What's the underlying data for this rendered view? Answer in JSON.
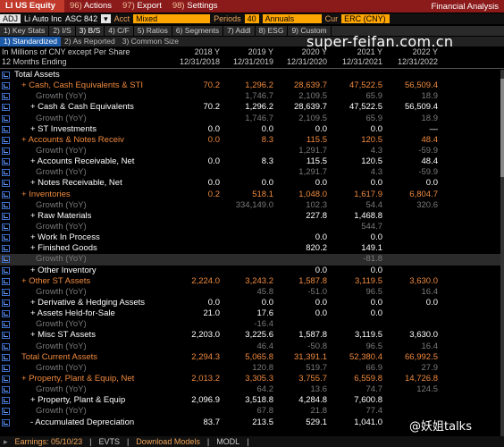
{
  "top": {
    "ticker": "LI US Equity",
    "menus": [
      {
        "num": "96)",
        "label": "Actions"
      },
      {
        "num": "97)",
        "label": "Export"
      },
      {
        "num": "98)",
        "label": "Settings"
      }
    ],
    "title": "Financial Analysis"
  },
  "params": {
    "adj": "ADJ",
    "company": "Li Auto Inc",
    "asc": "ASC 842",
    "acct_label": "Acct",
    "acct_value": "Mixed",
    "periods_label": "Periods",
    "periods_value": "40",
    "freq": "Annuals",
    "cur_label": "Cur",
    "cur_value": "ERC (CNY)"
  },
  "tabs": [
    "1) Key Stats",
    "2) I/S",
    "3) B/S",
    "4) C/F",
    "5) Ratios",
    "6) Segments",
    "7) Addl",
    "8) ESG",
    "9) Custom"
  ],
  "subtabs": [
    "1) Standardized",
    "2) As Reported",
    "3) Common Size"
  ],
  "subtab_active": 0,
  "watermark": "super-feifan.com.cn",
  "header": {
    "units": "In Millions of CNY except Per Share",
    "period_label": "12 Months Ending",
    "years": [
      "2018 Y",
      "2019 Y",
      "2020 Y",
      "2021 Y",
      "2022 Y"
    ],
    "dates": [
      "12/31/2018",
      "12/31/2019",
      "12/31/2020",
      "12/31/2021",
      "12/31/2022"
    ]
  },
  "rows": [
    {
      "kind": "sec",
      "label": "Total Assets",
      "values": [
        "",
        "",
        "",
        "",
        ""
      ]
    },
    {
      "kind": "main",
      "label": "+ Cash, Cash Equivalents & STI",
      "values": [
        "70.2",
        "1,296.2",
        "28,639.7",
        "47,522.5",
        "56,509.4"
      ]
    },
    {
      "kind": "g",
      "label": "Growth (YoY)",
      "values": [
        "",
        "1,746.7",
        "2,109.5",
        "65.9",
        "18.9"
      ]
    },
    {
      "kind": "sub",
      "label": "+ Cash & Cash Equivalents",
      "values": [
        "70.2",
        "1,296.2",
        "28,639.7",
        "47,522.5",
        "56,509.4"
      ]
    },
    {
      "kind": "g",
      "label": "Growth (YoY)",
      "values": [
        "",
        "1,746.7",
        "2,109.5",
        "65.9",
        "18.9"
      ]
    },
    {
      "kind": "sub",
      "label": "+ ST Investments",
      "values": [
        "0.0",
        "0.0",
        "0.0",
        "0.0",
        "—"
      ]
    },
    {
      "kind": "main",
      "label": "+ Accounts & Notes Receiv",
      "values": [
        "0.0",
        "8.3",
        "115.5",
        "120.5",
        "48.4"
      ]
    },
    {
      "kind": "g",
      "label": "Growth (YoY)",
      "values": [
        "",
        "",
        "1,291.7",
        "4.3",
        "-59.9"
      ]
    },
    {
      "kind": "sub",
      "label": "+ Accounts Receivable, Net",
      "values": [
        "0.0",
        "8.3",
        "115.5",
        "120.5",
        "48.4"
      ]
    },
    {
      "kind": "g",
      "label": "Growth (YoY)",
      "values": [
        "",
        "",
        "1,291.7",
        "4.3",
        "-59.9"
      ]
    },
    {
      "kind": "sub",
      "label": "+ Notes Receivable, Net",
      "values": [
        "0.0",
        "0.0",
        "0.0",
        "0.0",
        "0.0"
      ]
    },
    {
      "kind": "main",
      "label": "+ Inventories",
      "values": [
        "0.2",
        "518.1",
        "1,048.0",
        "1,617.9",
        "6,804.7"
      ]
    },
    {
      "kind": "g",
      "label": "Growth (YoY)",
      "values": [
        "",
        "334,149.0",
        "102.3",
        "54.4",
        "320.6"
      ]
    },
    {
      "kind": "sub",
      "label": "+ Raw Materials",
      "values": [
        "",
        "",
        "227.8",
        "1,468.8",
        ""
      ]
    },
    {
      "kind": "g",
      "label": "Growth (YoY)",
      "values": [
        "",
        "",
        "",
        "544.7",
        ""
      ]
    },
    {
      "kind": "sub",
      "label": "+ Work In Process",
      "values": [
        "",
        "",
        "0.0",
        "0.0",
        ""
      ]
    },
    {
      "kind": "sub",
      "label": "+ Finished Goods",
      "values": [
        "",
        "",
        "820.2",
        "149.1",
        ""
      ]
    },
    {
      "kind": "g",
      "label": "Growth (YoY)",
      "values": [
        "",
        "",
        "",
        "-81.8",
        ""
      ],
      "hl": true
    },
    {
      "kind": "sub",
      "label": "+ Other Inventory",
      "values": [
        "",
        "",
        "0.0",
        "0.0",
        ""
      ]
    },
    {
      "kind": "main",
      "label": "+ Other ST Assets",
      "values": [
        "2,224.0",
        "3,243.2",
        "1,587.8",
        "3,119.5",
        "3,630.0"
      ]
    },
    {
      "kind": "g",
      "label": "Growth (YoY)",
      "values": [
        "",
        "45.8",
        "-51.0",
        "96.5",
        "16.4"
      ]
    },
    {
      "kind": "sub",
      "label": "+ Derivative & Hedging Assets",
      "values": [
        "0.0",
        "0.0",
        "0.0",
        "0.0",
        "0.0"
      ]
    },
    {
      "kind": "sub",
      "label": "+ Assets Held-for-Sale",
      "values": [
        "21.0",
        "17.6",
        "0.0",
        "0.0",
        ""
      ]
    },
    {
      "kind": "g",
      "label": "Growth (YoY)",
      "values": [
        "",
        "-16.4",
        "",
        "",
        ""
      ]
    },
    {
      "kind": "sub",
      "label": "+ Misc ST Assets",
      "values": [
        "2,203.0",
        "3,225.6",
        "1,587.8",
        "3,119.5",
        "3,630.0"
      ]
    },
    {
      "kind": "g",
      "label": "Growth (YoY)",
      "values": [
        "",
        "46.4",
        "-50.8",
        "96.5",
        "16.4"
      ]
    },
    {
      "kind": "main",
      "label": "Total Current Assets",
      "values": [
        "2,294.3",
        "5,065.8",
        "31,391.1",
        "52,380.4",
        "66,992.5"
      ]
    },
    {
      "kind": "g",
      "label": "Growth (YoY)",
      "values": [
        "",
        "120.8",
        "519.7",
        "66.9",
        "27.9"
      ]
    },
    {
      "kind": "main",
      "label": "+ Property, Plant & Equip, Net",
      "values": [
        "2,013.2",
        "3,305.3",
        "3,755.7",
        "6,559.8",
        "14,726.8"
      ]
    },
    {
      "kind": "g",
      "label": "Growth (YoY)",
      "values": [
        "",
        "64.2",
        "13.6",
        "74.7",
        "124.5"
      ]
    },
    {
      "kind": "sub",
      "label": "+ Property, Plant & Equip",
      "values": [
        "2,096.9",
        "3,518.8",
        "4,284.8",
        "7,600.8",
        ""
      ]
    },
    {
      "kind": "g",
      "label": "Growth (YoY)",
      "values": [
        "",
        "67.8",
        "21.8",
        "77.4",
        ""
      ]
    },
    {
      "kind": "sub",
      "label": "- Accumulated Depreciation",
      "values": [
        "83.7",
        "213.5",
        "529.1",
        "1,041.0",
        ""
      ]
    }
  ],
  "footer": {
    "earnings": "Earnings: 05/10/23",
    "evts": "EVTS",
    "download": "Download Models",
    "modl": "MODL"
  },
  "watermark2": "@妖姐talks"
}
